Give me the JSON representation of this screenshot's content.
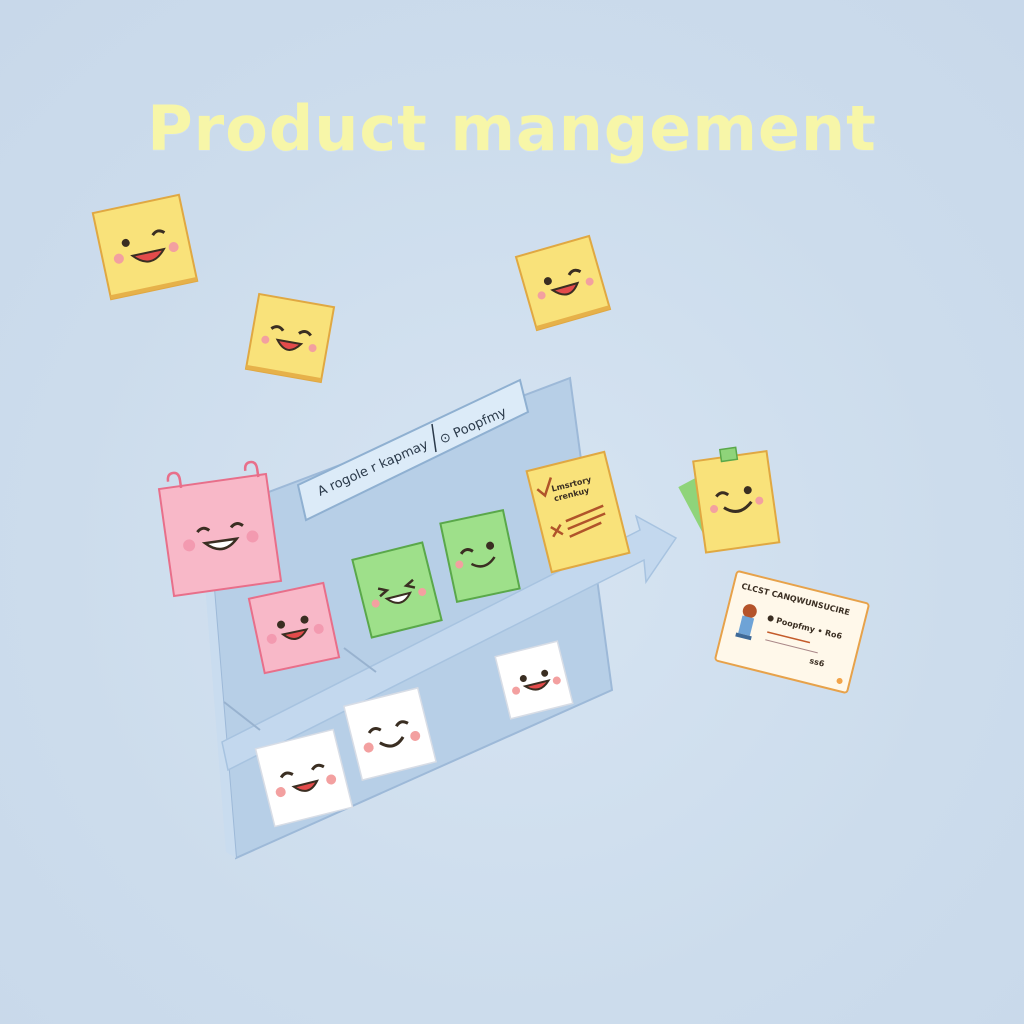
{
  "title": "Product mangement",
  "board": {
    "tab_left_label": "A rogole r kapmay",
    "tab_right_label": "⊙ Poopfmy"
  },
  "checklist_note": {
    "line1": "Lmsrtory",
    "line2": "crenkuy"
  },
  "profile_card": {
    "title": "CLCST CANQWUNSUCIRE",
    "row1": "Poopfmy • Ro6",
    "row2": "ss6"
  },
  "colors": {
    "background": "#cfdeee",
    "title": "#f7f6a8",
    "yellow_note": "#f9e27a",
    "pink_note": "#f8b8c8",
    "green_note": "#9ee08a",
    "white_note": "#ffffff",
    "board": "#b4cde6"
  }
}
